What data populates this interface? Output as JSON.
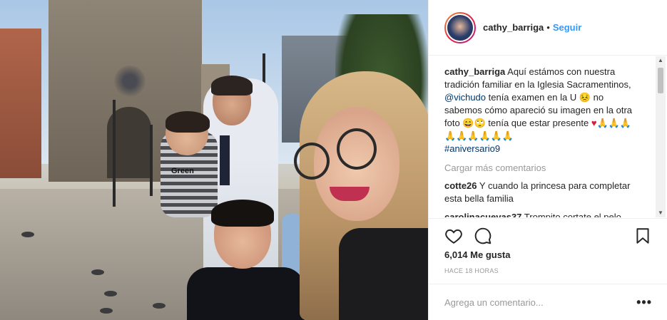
{
  "header": {
    "username": "cathy_barriga",
    "separator": "•",
    "follow_label": "Seguir"
  },
  "photo": {
    "shirt_text": "Green"
  },
  "caption": {
    "username": "cathy_barriga",
    "text_part1": "Aquí estámos con nuestra tradición familiar en la Iglesia Sacramentinos, ",
    "mention": "@vichudo",
    "text_part2": " tenía examen en la U 😣 no sabemos cómo apareció su imagen en la otra foto 😄🙄 tenía que estar presente ",
    "heart": "♥",
    "emojis": "🙏🙏🙏🙏🙏🙏🙏🙏🙏",
    "hashtag": "#aniversario9"
  },
  "load_more_label": "Cargar más comentarios",
  "comments": [
    {
      "username": "cotte26",
      "text": "Y cuando la princesa para completar esta bella familia"
    },
    {
      "username": "carolinacuevas37",
      "text": "Trompito cortate el pelo"
    }
  ],
  "likes_label": "6,014 Me gusta",
  "time_label": "HACE 18 HORAS",
  "comment_input": {
    "placeholder": "Agrega un comentario..."
  },
  "more_label": "•••",
  "icons": {
    "like": "heart-outline-icon",
    "comment": "speech-bubble-icon",
    "save": "bookmark-icon"
  },
  "colors": {
    "link": "#003569",
    "follow": "#3897f0",
    "muted": "#999999"
  }
}
